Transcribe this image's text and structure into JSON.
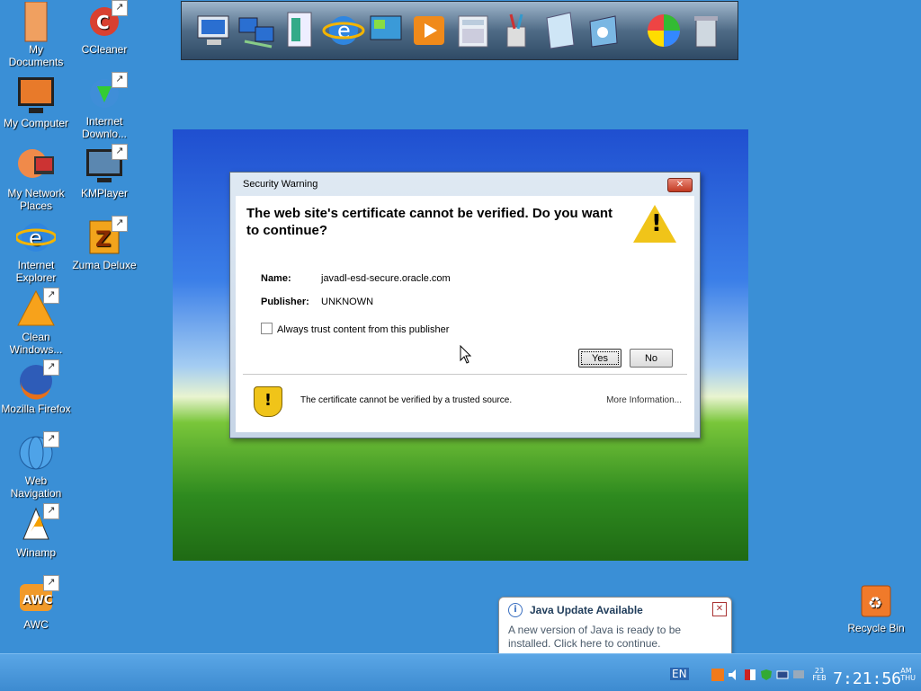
{
  "desktop": {
    "icons": [
      {
        "label": "My Documents"
      },
      {
        "label": "CCleaner"
      },
      {
        "label": "My Computer"
      },
      {
        "label": "Internet Downlo..."
      },
      {
        "label": "My Network Places"
      },
      {
        "label": "KMPlayer"
      },
      {
        "label": "Internet Explorer"
      },
      {
        "label": "Zuma Deluxe"
      },
      {
        "label": "Clean Windows..."
      },
      {
        "label": "Mozilla Firefox"
      },
      {
        "label": "Web Navigation"
      },
      {
        "label": "Winamp"
      },
      {
        "label": "AWC"
      },
      {
        "label": "Recycle Bin"
      }
    ]
  },
  "dialog": {
    "title": "Security Warning",
    "heading": "The web site's certificate cannot be verified. Do you want to continue?",
    "name_label": "Name:",
    "name_value": "javadl-esd-secure.oracle.com",
    "publisher_label": "Publisher:",
    "publisher_value": "UNKNOWN",
    "checkbox_label": "Always trust content from this publisher",
    "yes_label": "Yes",
    "no_label": "No",
    "footer_text": "The certificate cannot be verified by a trusted source.",
    "more_info": "More Information..."
  },
  "balloon": {
    "title": "Java Update Available",
    "text": "A new version of Java is ready to be installed. Click here to continue."
  },
  "taskbar": {
    "language": "EN",
    "clock": "7:21:56",
    "date_day": "23",
    "date_month": "FEB",
    "am_pm": "AM",
    "weekday": "THU"
  }
}
